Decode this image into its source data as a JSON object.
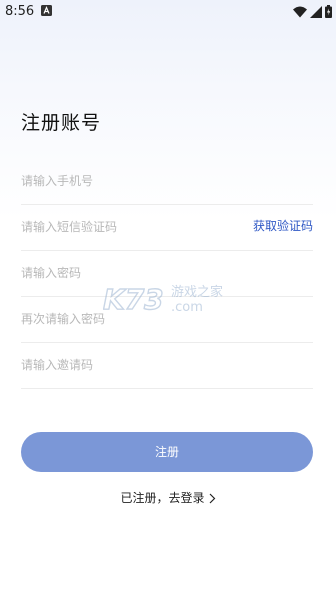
{
  "status_bar": {
    "time": "8:56",
    "icons": [
      "app-notification-icon",
      "wifi-icon",
      "signal-icon",
      "battery-icon"
    ]
  },
  "title": "注册账号",
  "form": {
    "phone_placeholder": "请输入手机号",
    "sms_code_placeholder": "请输入短信验证码",
    "get_code_label": "获取验证码",
    "password_placeholder": "请输入密码",
    "confirm_password_placeholder": "再次请输入密码",
    "invite_code_placeholder": "请输入邀请码"
  },
  "register_button_label": "注册",
  "login_prompt": "已注册，去登录",
  "watermark": {
    "brand": "K73",
    "text": "游戏之家",
    "domain": ".com"
  },
  "colors": {
    "accent": "#2f58c5",
    "button": "#7b97d7",
    "placeholder": "#b8b8b8"
  }
}
